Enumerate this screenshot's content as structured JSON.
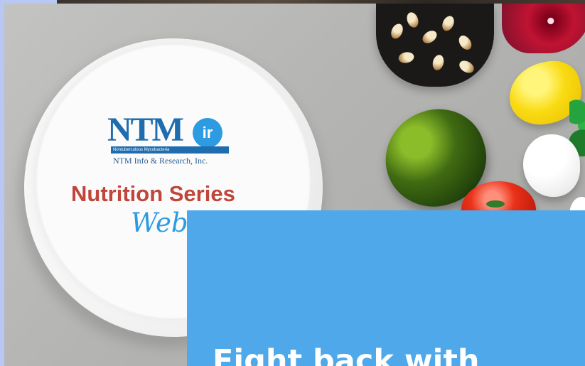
{
  "hero": {
    "brand": {
      "logo_main": "NTM",
      "logo_badge": "ir",
      "logo_band": "Nontuberculous Mycobacteria",
      "organization_name": "NTM Info & Research, Inc."
    },
    "series_title": "Nutrition Series",
    "series_subtitle": "Webinar"
  },
  "promo_card": {
    "headline": "Fight back with"
  },
  "colors": {
    "brand_blue": "#1f6cae",
    "accent_red": "#c0453a",
    "card_blue": "#4ea8ea",
    "script_blue": "#2d9be2"
  }
}
